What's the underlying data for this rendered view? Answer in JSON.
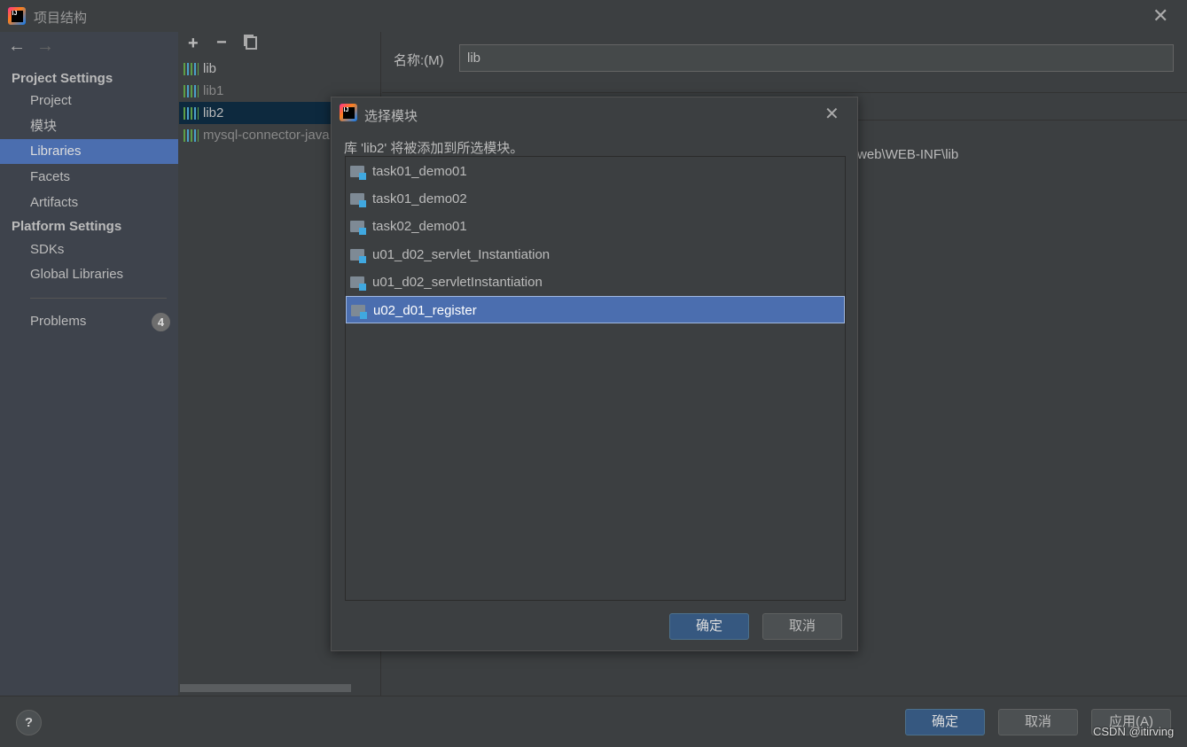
{
  "window": {
    "title": "项目结构",
    "close_icon": "close-icon"
  },
  "sidebar": {
    "sections": [
      {
        "title": "Project Settings",
        "items": [
          "Project",
          "模块",
          "Libraries",
          "Facets",
          "Artifacts"
        ]
      },
      {
        "title": "Platform Settings",
        "items": [
          "SDKs",
          "Global Libraries"
        ]
      }
    ],
    "selected": "Libraries",
    "problems": {
      "label": "Problems",
      "count": "4"
    }
  },
  "libraries": {
    "items": [
      "lib",
      "lib1",
      "lib2",
      "mysql-connector-java"
    ],
    "selected": "lib2"
  },
  "details": {
    "name_label": "名称:(M)",
    "name_value": "lib",
    "path_fragment": "'\\web\\WEB-INF\\lib"
  },
  "dialog": {
    "title": "选择模块",
    "message": "库 'lib2' 将被添加到所选模块。",
    "modules": [
      "task01_demo01",
      "task01_demo02",
      "task02_demo01",
      "u01_d02_servlet_Instantiation",
      "u01_d02_servletInstantiation",
      "u02_d01_register"
    ],
    "selected": "u02_d01_register",
    "ok": "确定",
    "cancel": "取消"
  },
  "footer": {
    "help": "?",
    "ok": "确定",
    "cancel": "取消",
    "apply": "应用(A)"
  },
  "watermark": "CSDN @itirving",
  "colors": {
    "selection": "#4b6eaf",
    "primary_button": "#365880"
  }
}
